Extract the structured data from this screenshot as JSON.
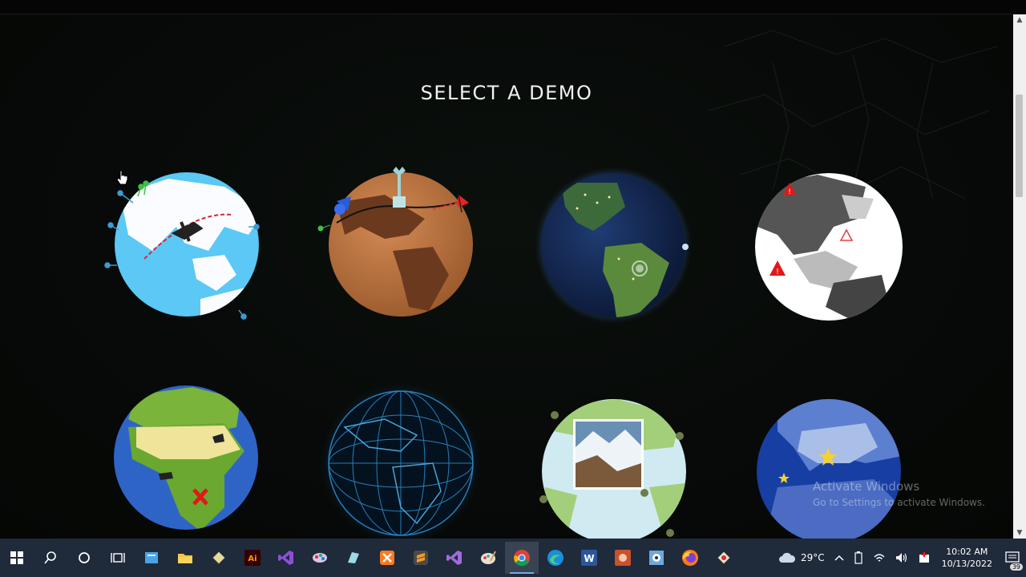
{
  "page": {
    "heading": "SELECT A DEMO"
  },
  "demos": [
    {
      "name": "flights-globe"
    },
    {
      "name": "cork-board-globe"
    },
    {
      "name": "night-lights-globe"
    },
    {
      "name": "alerts-globe"
    },
    {
      "name": "africa-cartoon-globe"
    },
    {
      "name": "wireframe-globe"
    },
    {
      "name": "photo-pins-globe"
    },
    {
      "name": "europe-globe"
    }
  ],
  "watermark": {
    "line1": "Activate Windows",
    "line2": "Go to Settings to activate Windows."
  },
  "taskbar": {
    "apps": [
      "windows-start-icon",
      "search-icon",
      "cortana-icon",
      "task-view-icon",
      "notepad-icon",
      "file-explorer-icon",
      "app-icon",
      "illustrator-icon",
      "visual-studio-icon",
      "paint-icon",
      "app-icon-2",
      "xampp-icon",
      "sublime-text-icon",
      "visual-studio-2-icon",
      "paint-palette-icon",
      "chrome-icon",
      "edge-icon",
      "word-icon",
      "powerpoint-icon",
      "app-icon-3",
      "firefox-icon",
      "app-icon-4"
    ],
    "illustrator_label": "Ai",
    "word_label": "W",
    "weather": "29°C",
    "time": "10:02 AM",
    "date": "10/13/2022",
    "notification_count": "39"
  }
}
